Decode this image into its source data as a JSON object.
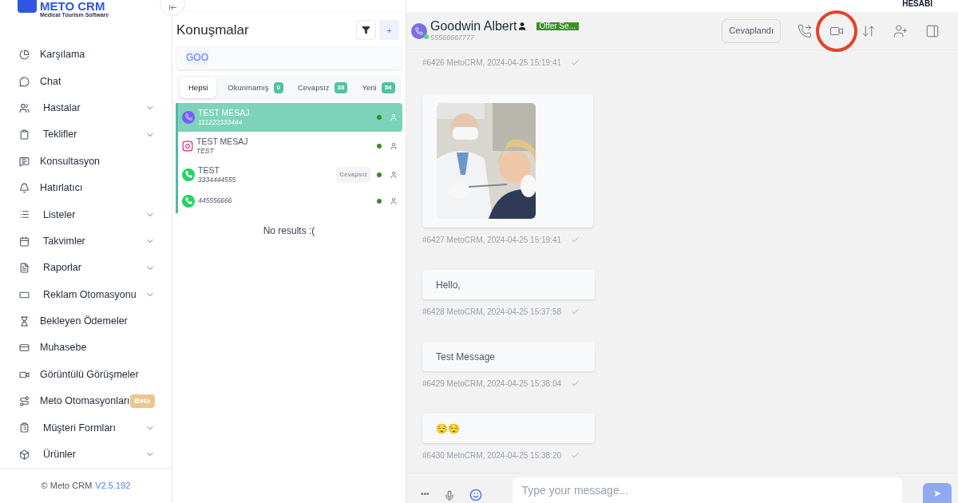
{
  "brand": {
    "name": "METO CRM",
    "tagline": "Medical Tourism Software"
  },
  "top_bar": {
    "account_label": "HESABI"
  },
  "sidebar": {
    "items": [
      {
        "label": "Karşılama",
        "expandable": false
      },
      {
        "label": "Chat",
        "expandable": false
      },
      {
        "label": "Hastalar",
        "expandable": true
      },
      {
        "label": "Teklifler",
        "expandable": true
      },
      {
        "label": "Konsultasyon",
        "expandable": false
      },
      {
        "label": "Hatırlatıcı",
        "expandable": false
      },
      {
        "label": "Listeler",
        "expandable": true
      },
      {
        "label": "Takvimler",
        "expandable": true
      },
      {
        "label": "Raporlar",
        "expandable": true
      },
      {
        "label": "Reklam Otomasyonu",
        "expandable": true
      },
      {
        "label": "Bekleyen Ödemeler",
        "expandable": false
      },
      {
        "label": "Muhasebe",
        "expandable": false
      },
      {
        "label": "Görüntülü Görüşmeler",
        "expandable": false
      },
      {
        "label": "Meto Otomasyonları",
        "expandable": false,
        "badge": "Beta"
      },
      {
        "label": "Müşteri Formları",
        "expandable": true
      },
      {
        "label": "Ürünler",
        "expandable": true
      }
    ],
    "footer": {
      "copyright": "© Meto CRM",
      "version": "V2.5.192"
    }
  },
  "conversations": {
    "title": "Konuşmalar",
    "add_label": "+",
    "search": {
      "value": "GOO"
    },
    "tabs": [
      {
        "label": "Hepsi",
        "selected": true
      },
      {
        "label": "Okunmamış",
        "count": "0",
        "selected": false
      },
      {
        "label": "Cevapsız",
        "count": "38",
        "selected": false
      },
      {
        "label": "Yeni",
        "count": "54",
        "selected": false
      }
    ],
    "items": [
      {
        "kind": "viber",
        "name": "TEST MESAJ",
        "subtitle": "111222333444",
        "selected": true
      },
      {
        "kind": "instagram",
        "name": "TEST MESAJ",
        "subtitle": "TEST",
        "selected": false
      },
      {
        "kind": "whatsapp",
        "name": "TEST",
        "subtitle": "3334444555",
        "tag": "Cevapsız",
        "selected": false
      },
      {
        "kind": "whatsapp",
        "subtitle": "445556666",
        "selected": false
      }
    ],
    "empty_text": "No results :("
  },
  "chat": {
    "contact": {
      "name": "Goodwin Albert",
      "phone": "55566667777",
      "tag": "Offer Se..."
    },
    "status_button": "Cevaplandı",
    "actions": [
      {
        "highlighted": false
      },
      {
        "highlighted": true
      },
      {
        "highlighted": false
      },
      {
        "highlighted": false
      },
      {
        "highlighted": false
      }
    ],
    "messages": [
      {
        "kind": "meta",
        "meta": "#6426 MetoCRM, 2024-04-25 15:19:41"
      },
      {
        "kind": "picture",
        "meta": "#6427 MetoCRM, 2024-04-25 15:19:41"
      },
      {
        "kind": "text",
        "text": "Hello,",
        "meta": "#6428 MetoCRM, 2024-04-25 15:37:58"
      },
      {
        "kind": "text",
        "text": "Test Message",
        "meta": "#6429 MetoCRM, 2024-04-25 15:38:04"
      },
      {
        "kind": "text",
        "text": "😌😌",
        "meta": "#6430 MetoCRM, 2024-04-25 15:38:20"
      }
    ],
    "composer": {
      "more_label": "•••",
      "placeholder": "Type your message...",
      "send_label": "➤"
    }
  }
}
